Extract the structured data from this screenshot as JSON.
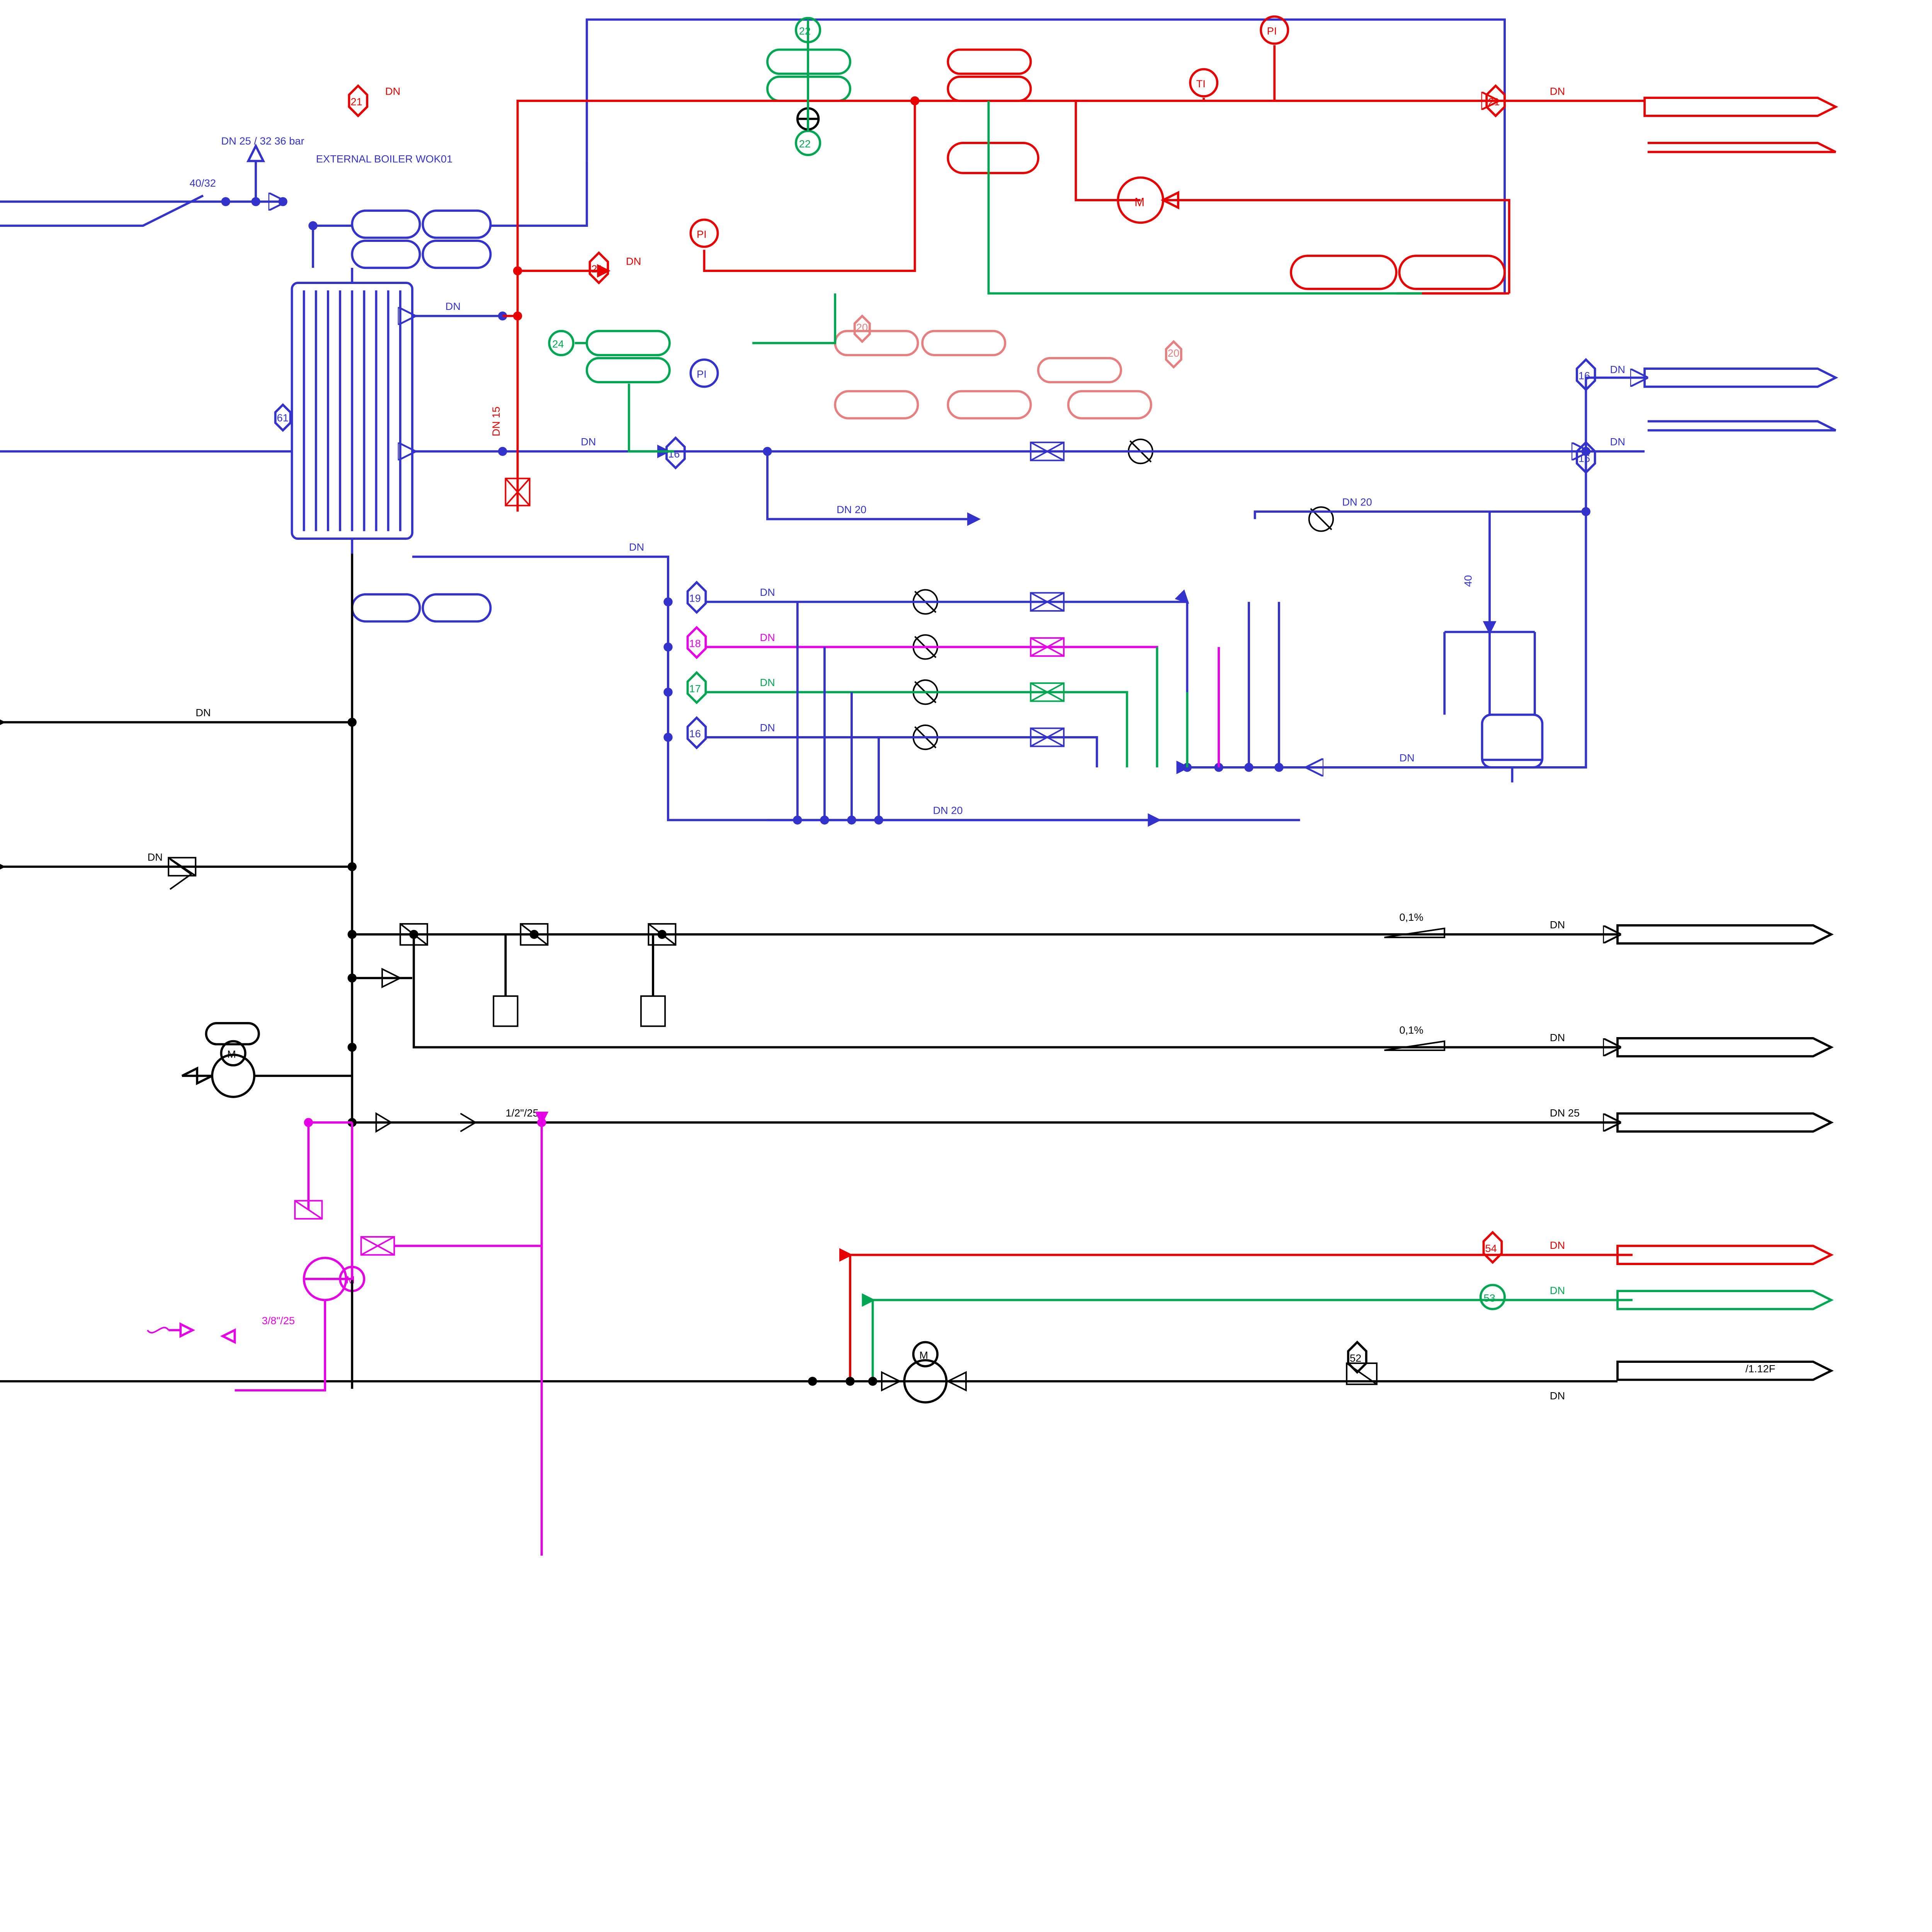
{
  "title": "EXTERNAL BOILER WOK01",
  "spec": "DN 25 / 32 36 bar",
  "red40_32": "40/32",
  "half_25": "1/2\"/25",
  "three8_25": "3/8\"/25",
  "pct": "0,1%",
  "dn": "DN",
  "dn15": "DN 15",
  "dn20": "DN 20",
  "dn25": "DN 25",
  "forty": "40",
  "ref": "/1.12F",
  "tag": {
    "o16a": "16",
    "o16b": "16",
    "o16c": "16",
    "o16d": "16",
    "o17": "17",
    "o18": "18",
    "o19": "19",
    "o20a": "20",
    "o20b": "20",
    "o21a": "21",
    "o21b": "21",
    "o21c": "21",
    "c22a": "22",
    "c22b": "22",
    "c24": "24",
    "o52": "52",
    "c53": "53",
    "o54": "54",
    "o61": "61",
    "m1": "M",
    "m2": "M",
    "m3": "M",
    "m4": "M",
    "pi1": "PI",
    "pi2": "PI",
    "pi3": "PI",
    "ti": "TI"
  }
}
